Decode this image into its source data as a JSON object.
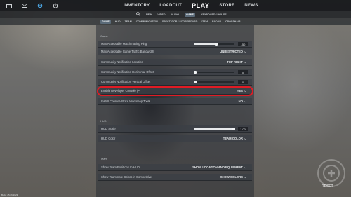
{
  "topbar": {
    "icons": [
      "inventory-case-icon",
      "mail-icon",
      "settings-gear-icon",
      "power-icon"
    ],
    "nav": [
      "INVENTORY",
      "LOADOUT",
      "PLAY",
      "STORE",
      "NEWS"
    ]
  },
  "subnav": {
    "items": [
      "NEW",
      "VIDEO",
      "AUDIO",
      "GAME",
      "KEYBOARD / MOUSE"
    ],
    "active": "GAME"
  },
  "tabs": {
    "items": [
      "GAME",
      "HUD",
      "TEAM",
      "COMMUNICATION",
      "SPECTATOR / SCOREBOARD",
      "ITEM",
      "RADAR",
      "CROSSHAIR"
    ],
    "active": "GAME"
  },
  "sections": {
    "game": "Game",
    "hud": "HUD",
    "team": "Team"
  },
  "game_rows": {
    "max_ping": {
      "label": "Max Acceptable Matchmaking Ping",
      "value": "150",
      "slider": 0.55
    },
    "bandwidth": {
      "label": "Max Acceptable Game Traffic Bandwidth",
      "value": "UNRESTRICTED"
    },
    "notif_location": {
      "label": "Community Notification Location",
      "value": "TOP RIGHT"
    },
    "notif_h_offset": {
      "label": "Community Notification Horizontal Offset",
      "value": "0",
      "slider": 0.02
    },
    "notif_v_offset": {
      "label": "Community Notification Vertical Offset",
      "value": "0",
      "slider": 0.02
    },
    "dev_console": {
      "label": "Enable Developer Console (~)",
      "value": "YES"
    },
    "workshop_tools": {
      "label": "Install Counter-Strike Workshop Tools",
      "value": "NO"
    }
  },
  "hud_rows": {
    "hud_scale": {
      "label": "HUD Scale",
      "value": "1.00",
      "slider": 1.0
    },
    "hud_color": {
      "label": "HUD Color",
      "value": "TEAM COLOR"
    }
  },
  "team_rows": {
    "team_positions": {
      "label": "Show Team Positions In HUD",
      "value": "SHOW LOCATION AND EQUIPMENT"
    },
    "teammate_colors": {
      "label": "Show Teammate Colors in Competitive",
      "value": "SHOW COLORS"
    }
  },
  "watermark": {
    "text": "RESET"
  },
  "build": "Build: 25.06.2023",
  "colors": {
    "highlight": "#e01b24",
    "active_tab": "#5a6a78"
  }
}
